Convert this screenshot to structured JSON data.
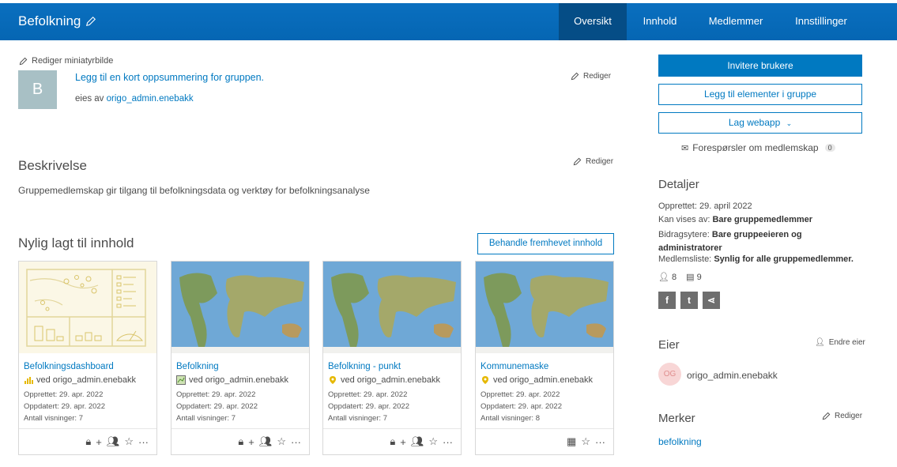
{
  "header": {
    "title": "Befolkning",
    "tabs": [
      {
        "label": "Oversikt",
        "active": true
      },
      {
        "label": "Innhold",
        "active": false
      },
      {
        "label": "Medlemmer",
        "active": false
      },
      {
        "label": "Innstillinger",
        "active": false
      }
    ]
  },
  "summary": {
    "edit_thumbnail_label": "Rediger miniatyrbilde",
    "thumbnail_letter": "B",
    "summary_link": "Legg til en kort oppsummering for gruppen.",
    "owned_by_prefix": "eies av",
    "owner_link": "origo_admin.enebakk",
    "edit_label": "Rediger"
  },
  "description": {
    "heading": "Beskrivelse",
    "edit_label": "Rediger",
    "text": "Gruppemedlemskap gir tilgang til befolkningsdata og verktøy for befolkningsanalyse"
  },
  "recent": {
    "heading": "Nylig lagt til innhold",
    "manage_button": "Behandle fremhevet innhold",
    "items": [
      {
        "title": "Befolkningsdashboard",
        "owner": "ved origo_admin.enebakk",
        "created": "Opprettet: 29. apr. 2022",
        "updated": "Oppdatert: 29. apr. 2022",
        "views": "Antall visninger: 7"
      },
      {
        "title": "Befolkning",
        "owner": "ved origo_admin.enebakk",
        "created": "Opprettet: 29. apr. 2022",
        "updated": "Oppdatert: 29. apr. 2022",
        "views": "Antall visninger: 7"
      },
      {
        "title": "Befolkning - punkt",
        "owner": "ved origo_admin.enebakk",
        "created": "Opprettet: 29. apr. 2022",
        "updated": "Oppdatert: 29. apr. 2022",
        "views": "Antall visninger: 7"
      },
      {
        "title": "Kommunemaske",
        "owner": "ved origo_admin.enebakk",
        "created": "Opprettet: 29. apr. 2022",
        "updated": "Oppdatert: 29. apr. 2022",
        "views": "Antall visninger: 8"
      }
    ]
  },
  "sidebar": {
    "invite_button": "Invitere brukere",
    "add_items_button": "Legg til elementer i gruppe",
    "create_webapp_button": "Lag webapp",
    "requests_label": "Forespørsler om medlemskap",
    "requests_count": "0",
    "details_heading": "Detaljer",
    "created": "Opprettet: 29. april 2022",
    "viewable_prefix": "Kan vises av:",
    "viewable_value": "Bare gruppemedlemmer",
    "contributors_prefix": "Bidragsytere:",
    "contributors_value": "Bare gruppeeieren og administratorer",
    "memberlist_prefix": "Medlemsliste:",
    "memberlist_value": "Synlig for alle gruppemedlemmer.",
    "member_count": "8",
    "item_count": "9",
    "owner_heading": "Eier",
    "change_owner_label": "Endre eier",
    "owner_initials": "OG",
    "owner_name": "origo_admin.enebakk",
    "tags_heading": "Merker",
    "tags_edit_label": "Rediger",
    "tags": [
      "befolkning"
    ]
  },
  "colors": {
    "brand": "#0079c1",
    "header": "#0566b3",
    "active_tab": "#054d86"
  }
}
